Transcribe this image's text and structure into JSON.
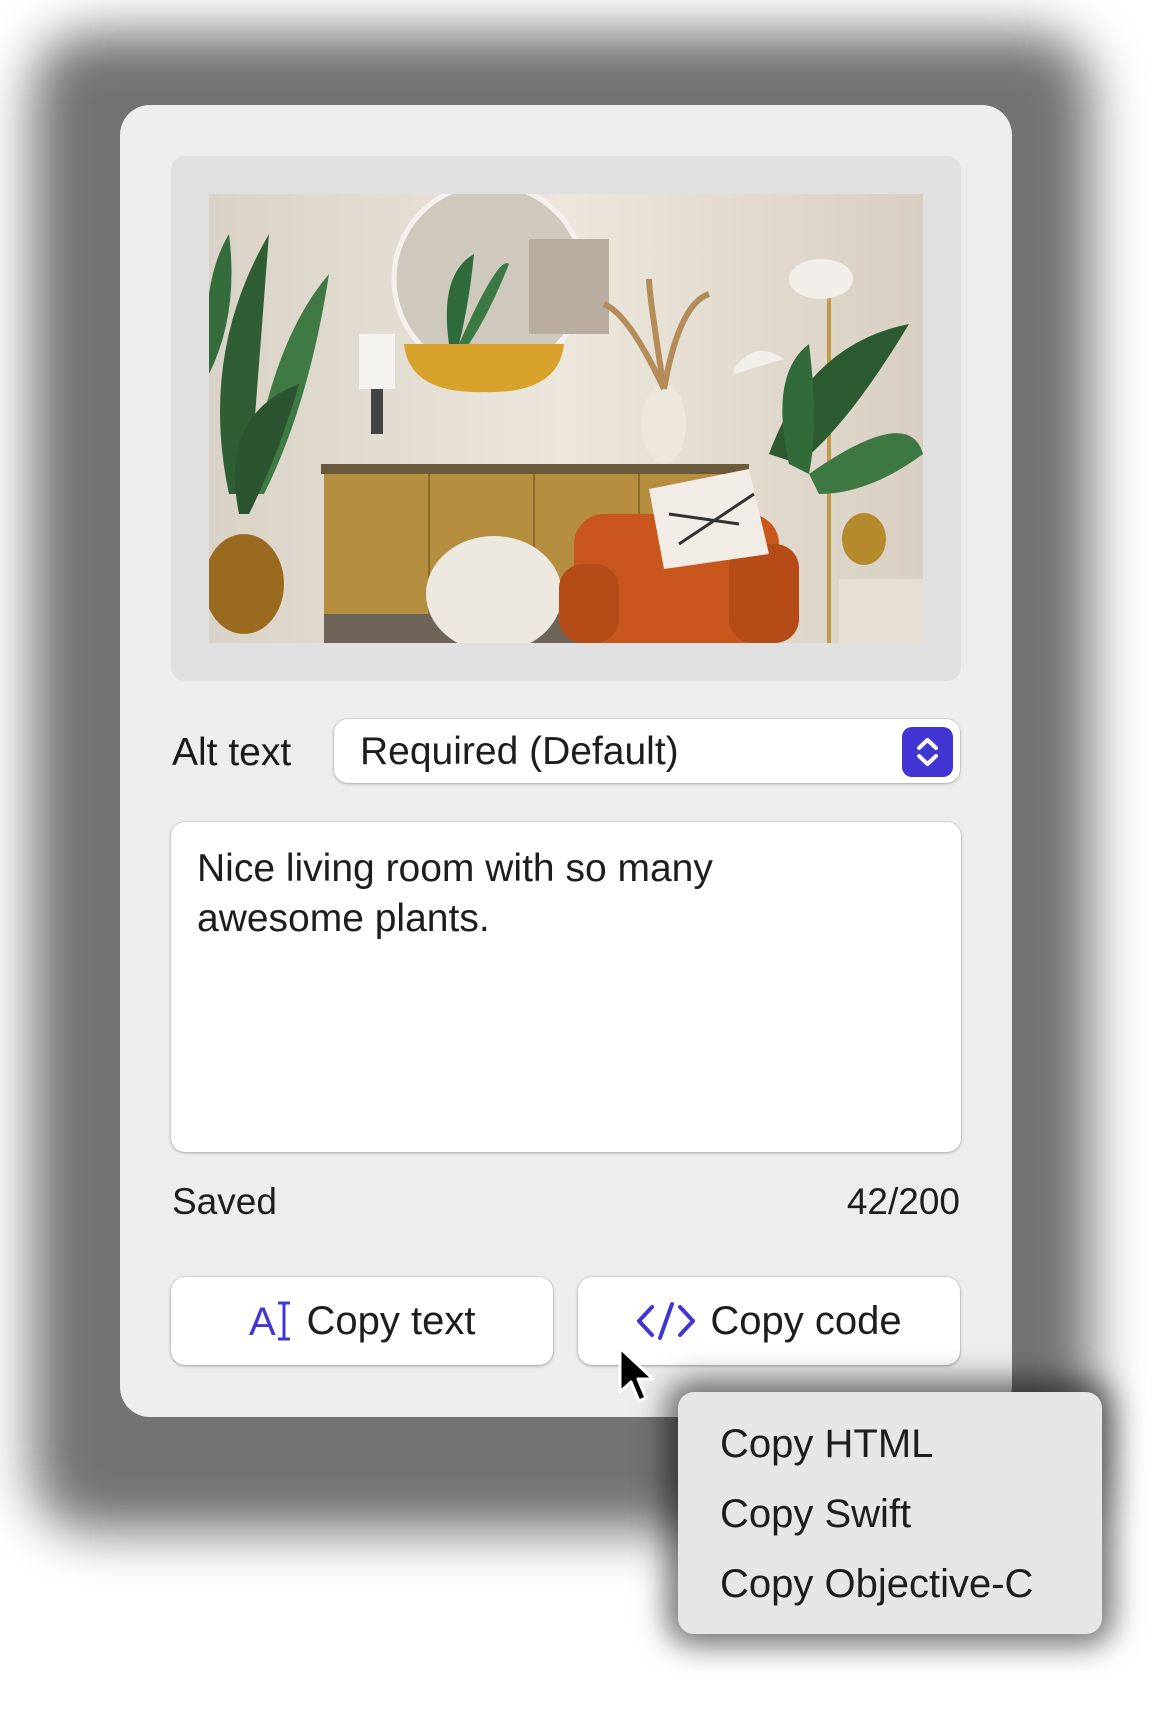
{
  "alt_text": {
    "label": "Alt text",
    "mode_select_value": "Required (Default)",
    "description_value": "Nice living room with so many awesome plants."
  },
  "status": {
    "save_state": "Saved",
    "char_count": "42/200"
  },
  "actions": {
    "copy_text_label": "Copy text",
    "copy_code_label": "Copy code"
  },
  "copy_code_menu": {
    "items": [
      "Copy HTML",
      "Copy Swift",
      "Copy Objective-C"
    ]
  },
  "icons": {
    "copy_text": "text-cursor-icon",
    "copy_code": "code-brackets-icon",
    "select": "chevron-up-down-icon",
    "pointer": "mouse-pointer-icon"
  },
  "colors": {
    "accent": "#4136d4",
    "panel": "#ededed",
    "menu": "#e6e6e6"
  }
}
